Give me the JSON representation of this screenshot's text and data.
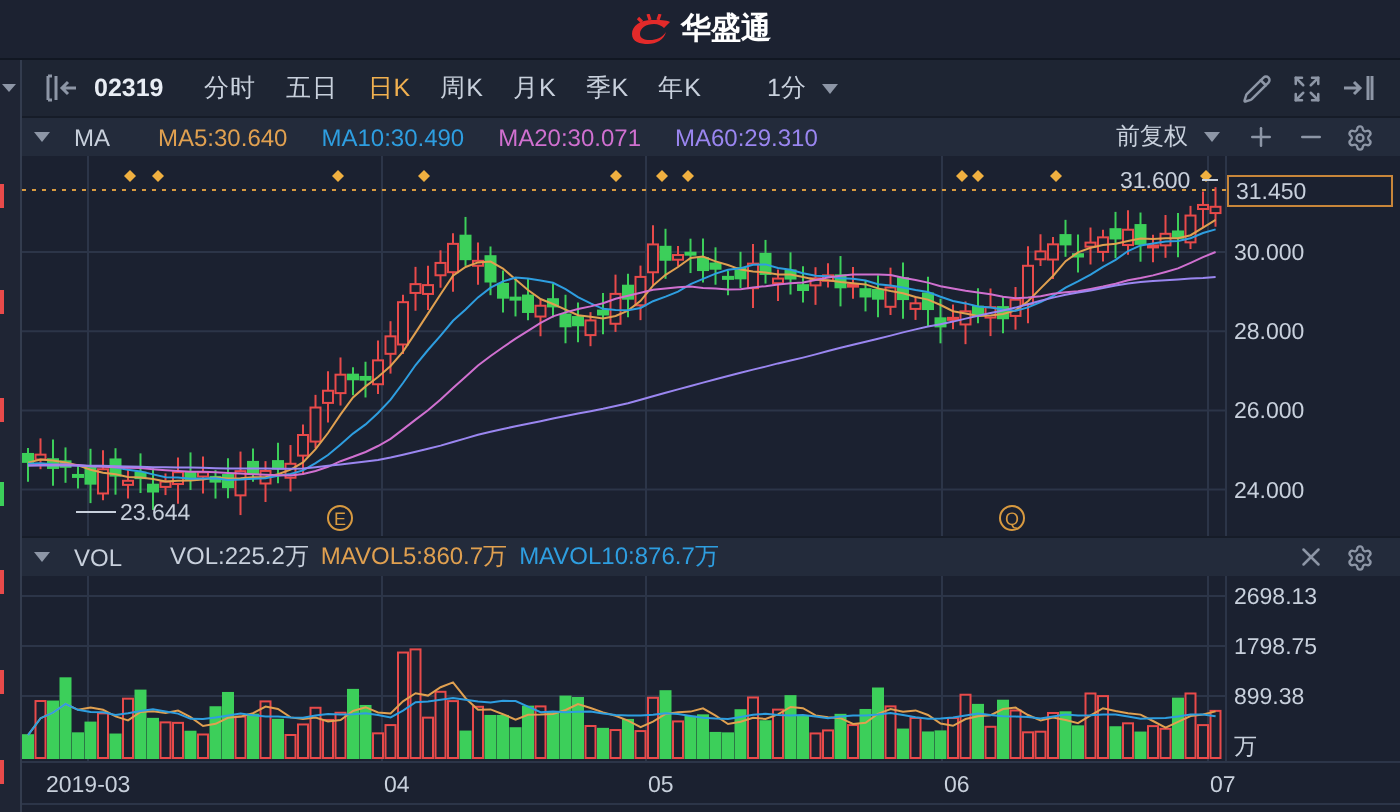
{
  "app": {
    "title": "华盛通"
  },
  "toolbar": {
    "symbol": "02319",
    "periods": [
      {
        "label": "分时",
        "selected": false
      },
      {
        "label": "五日",
        "selected": false
      },
      {
        "label": "日K",
        "selected": true
      },
      {
        "label": "周K",
        "selected": false
      },
      {
        "label": "月K",
        "selected": false
      },
      {
        "label": "季K",
        "selected": false
      },
      {
        "label": "年K",
        "selected": false
      }
    ],
    "interval": "1分"
  },
  "indicator_bar": {
    "name": "MA",
    "values": [
      {
        "label": "MA5:30.640",
        "color": "#e0a050"
      },
      {
        "label": "MA10:30.490",
        "color": "#2e9ee0"
      },
      {
        "label": "MA20:30.071",
        "color": "#d070d0"
      },
      {
        "label": "MA60:29.310",
        "color": "#9a86f0"
      }
    ],
    "adjustment": "前复权"
  },
  "price_chart": {
    "y_axis": [
      "30.000",
      "28.000",
      "26.000",
      "24.000"
    ],
    "current_price": "31.450",
    "high_label": "31.600",
    "low_label": "23.644",
    "events": [
      "E",
      "Q"
    ]
  },
  "volume_bar": {
    "name": "VOL",
    "values": [
      {
        "label": "VOL:225.2万",
        "color": "#c8d0dc"
      },
      {
        "label": "MAVOL5:860.7万",
        "color": "#e0a050"
      },
      {
        "label": "MAVOL10:876.7万",
        "color": "#2e9ee0"
      }
    ]
  },
  "volume_chart": {
    "y_axis": [
      "2698.13",
      "1798.75",
      "899.38"
    ],
    "unit": "万"
  },
  "x_axis": [
    "2019-03",
    "04",
    "05",
    "06",
    "07"
  ]
}
